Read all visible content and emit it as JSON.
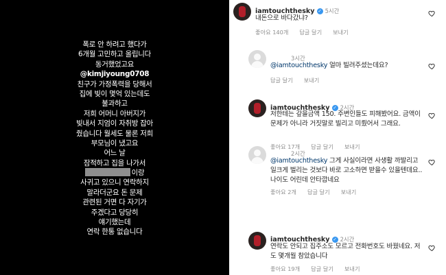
{
  "story": {
    "lines": [
      "폭로 안 하려고 했다가",
      "6개월 고민하고 올립니다",
      "동거했었고요",
      "@kimjiyoung0708",
      "친구가 가정폭력을 당해서",
      "집에 빚이 몇억 있는데도",
      "불과하고",
      "저희 어머니 아버지가",
      "빚내서 지엄이 자취방 잡아",
      "줬습니다 월세도 물론 저희",
      "부모님이 냈고요",
      "어느 날",
      "잠적하고 집을 나가서",
      "이랑",
      "사귀고 있으니 연락하지",
      "말라더군요 돈 문제",
      "관련된 거면 다 자기가",
      "주겠다고 당당히",
      "얘기했는데",
      "연락 한통 없습니다"
    ]
  },
  "comments": [
    {
      "username": "iamtouchthesky",
      "verified": true,
      "time": "5시간",
      "text": "내돈으로 바다갔냐?",
      "likes": "좋아요 140개",
      "reply": "답글 달기",
      "send": "보내기"
    },
    {
      "username": "",
      "verified": false,
      "time": "3시간",
      "mention": "@iamtouchthesky",
      "text": " 얼마 빌려주셨는데요?",
      "reply": "답글 달기",
      "send": "보내기"
    },
    {
      "username": "iamtouchthesky",
      "verified": true,
      "time": "2시간",
      "text": "저한테는 갚을금액 150. 주변인들도 피해봤어요. 금액이 문제가 아니라 거짓말로 빌리고 미뤘어서 그래요.",
      "likes": "좋아요 17개",
      "reply": "답글 달기",
      "send": "보내기"
    },
    {
      "username": "",
      "verified": false,
      "time": "2시간",
      "mention": "@iamtouchthesky",
      "text": " 그게 사실이라면 사생활 까발리고 일크게 벌리는 것보다 바로 고소하면 받을수 있을텐데요.. 나이도 어린데 안타깝네요",
      "likes": "좋아요 2개",
      "reply": "답글 달기",
      "send": "보내기"
    },
    {
      "username": "iamtouchthesky",
      "verified": true,
      "time": "2시간",
      "text": "연락도 안되고 집주소도 모르고 전화번호도 바꿨네요. 저도 몇개월 참았습니다",
      "likes": "좋아요 19개",
      "reply": "답글 달기",
      "send": "보내기"
    }
  ]
}
